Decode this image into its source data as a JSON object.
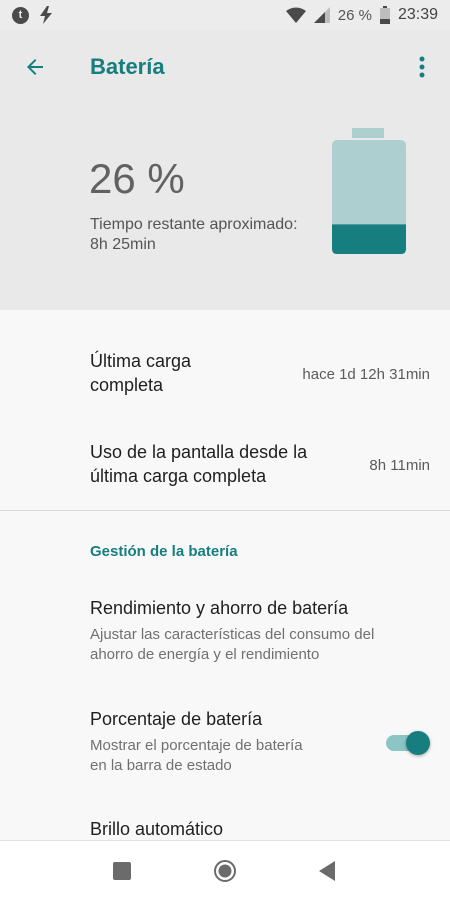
{
  "status_bar": {
    "left_icons": [
      "t-circle-icon",
      "lightning-icon"
    ],
    "notification_glyph": "t",
    "battery_percent": "26 %",
    "time": "23:39"
  },
  "header": {
    "title": "Batería",
    "battery_percent": "26 %",
    "time_remaining_label": "Tiempo restante aproximado:",
    "time_remaining_value": "8h 25min",
    "battery_level": 0.26
  },
  "stats": [
    {
      "label_line1": "Última carga",
      "label_line2": "completa",
      "value": "hace 1d 12h 31min"
    },
    {
      "label_line1": "Uso de la pantalla desde la",
      "label_line2": "última carga completa",
      "value": "8h 11min"
    }
  ],
  "section": {
    "title": "Gestión de la batería",
    "items": [
      {
        "title": "Rendimiento y ahorro de batería",
        "desc_line1": "Ajustar las características del consumo del",
        "desc_line2": "ahorro de energía y el rendimiento"
      },
      {
        "title": "Porcentaje de batería",
        "desc_line1": "Mostrar el porcentaje de batería",
        "desc_line2": "en la barra de estado",
        "toggle_on": true
      },
      {
        "title": "Brillo automático"
      }
    ]
  },
  "colors": {
    "accent": "#167e7f",
    "battery_empty": "#aecfd0",
    "battery_fill": "#167e7f"
  },
  "nav": {
    "buttons": [
      "recents-square-icon",
      "home-circle-icon",
      "back-triangle-icon"
    ]
  }
}
